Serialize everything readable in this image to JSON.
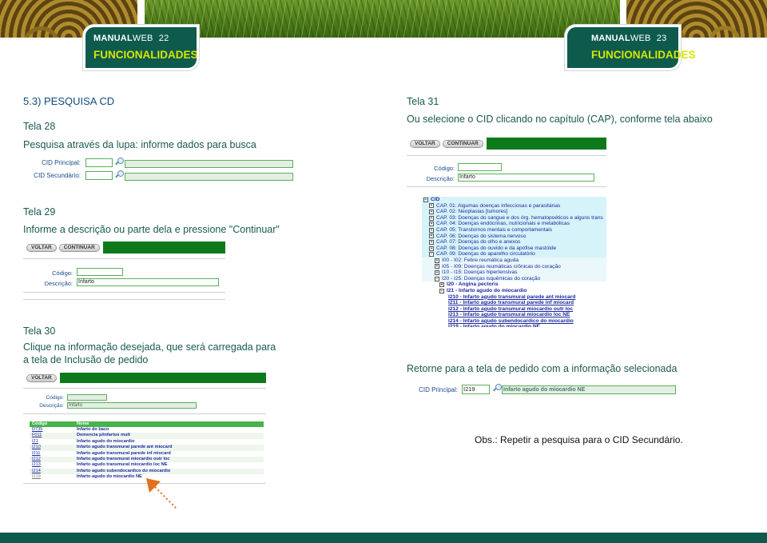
{
  "header": {
    "left": {
      "brand_bold": "MANUAL",
      "brand_light": "WEB",
      "page": "22",
      "section": "FUNCIONALIDADES"
    },
    "right": {
      "brand_bold": "MANUAL",
      "brand_light": "WEB",
      "page": "23",
      "section": "FUNCIONALIDADES"
    }
  },
  "left_page": {
    "section_title": "5.3) PESQUISA CD",
    "tela28": {
      "title": "Tela 28",
      "desc": "Pesquisa através da lupa: informe dados para busca",
      "cid_principal_label": "CID Principal:",
      "cid_secundario_label": "CID Secundário:"
    },
    "tela29": {
      "title": "Tela 29",
      "desc": "Informe a descrição ou parte dela e pressione \"Continuar\"",
      "btn_voltar": "VOLTAR",
      "btn_continuar": "CONTINUAR",
      "codigo_label": "Código:",
      "descricao_label": "Descrição:",
      "descricao_value": "Infarto"
    },
    "tela30": {
      "title": "Tela 30",
      "desc_line1": "Clique na informação desejada, que será carregada para",
      "desc_line2": "a tela de Inclusão de pedido",
      "btn_voltar": "VOLTAR",
      "codigo_label": "Código:",
      "descricao_label": "Descrição:",
      "descricao_value": "Infarto",
      "table_headers": [
        "Código",
        "Nome"
      ],
      "table_rows": [
        [
          "D735",
          "Infarto do baco"
        ],
        [
          "F011",
          "Demencia p/infartos mult"
        ],
        [
          "I21",
          "Infarto agudo do miocardio"
        ],
        [
          "I210",
          "Infarto agudo transmural parede ant miocard"
        ],
        [
          "I211",
          "Infarto agudo transmural parede inf miocard"
        ],
        [
          "I212",
          "Infarto agudo transmural miocardio outr loc"
        ],
        [
          "I213",
          "Infarto agudo transmural miocardio loc NE"
        ],
        [
          "I214",
          "Infarto agudo subendocardico do miocardio"
        ],
        [
          "I219",
          "Infarto agudo do miocardio NE"
        ]
      ]
    }
  },
  "right_page": {
    "tela31": {
      "title": "Tela 31",
      "desc": "Ou selecione o CID clicando no capítulo (CAP), conforme tela abaixo",
      "btn_voltar": "VOLTAR",
      "btn_continuar": "CONTINUAR",
      "codigo_label": "Código:",
      "descricao_label": "Descrição:",
      "descricao_value": "Infarto"
    },
    "tree": [
      {
        "sign": "−",
        "text": "CID",
        "bold": true
      },
      {
        "sign": "+",
        "text": "CAP. 01: Algumas doenças infecciosas e parasitárias"
      },
      {
        "sign": "+",
        "text": "CAP. 02: Neoplasias [tumores]"
      },
      {
        "sign": "+",
        "text": "CAP. 03: Doenças do sangue e dos órg. hematopoéticos e alguns trans"
      },
      {
        "sign": "+",
        "text": "CAP. 04: Doenças endócrinas, nutricionais e metabólicas"
      },
      {
        "sign": "+",
        "text": "CAP. 05: Transtornos mentais e comportamentais"
      },
      {
        "sign": "+",
        "text": "CAP. 06: Doenças do sistema nervoso"
      },
      {
        "sign": "+",
        "text": "CAP. 07: Doenças do olho e anexos"
      },
      {
        "sign": "+",
        "text": "CAP. 08: Doenças do ouvido e da apófise mastóide"
      },
      {
        "sign": "−",
        "text": "CAP. 09: Doenças do aparelho circulatório"
      },
      {
        "sign": "+",
        "text": "I00 - I02: Febre reumática aguda"
      },
      {
        "sign": "+",
        "text": "I05 - I09: Doenças reumáticas crônicas do coração"
      },
      {
        "sign": "+",
        "text": "I10 - I15: Doenças hipertensivas"
      },
      {
        "sign": "−",
        "text": "I20 - I25: Doenças isquêmicas do coração"
      },
      {
        "sign": "+",
        "text": "I20 - Angina pectoris",
        "bold": true
      },
      {
        "sign": "−",
        "text": "I21 - Infarto agudo do miocardio",
        "bold": true
      },
      {
        "sign": "",
        "text": "I210 - Infarto agudo transmural parede ant miocard",
        "bold": true
      },
      {
        "sign": "",
        "text": "I211 - Infarto agudo transmural parede inf miocard",
        "bold": true
      },
      {
        "sign": "",
        "text": "I212 - Infarto agudo transmural miocardio outr loc",
        "bold": true
      },
      {
        "sign": "",
        "text": "I213 - Infarto agudo transmural miocardio loc NE",
        "bold": true
      },
      {
        "sign": "",
        "text": "I214 - Infarto agudo subendocardico do miocardio",
        "bold": true
      },
      {
        "sign": "",
        "text": "I219 - Infarto agudo do miocardio NE",
        "bold": true
      }
    ],
    "return_text": "Retorne para a tela de pedido com a informação selecionada",
    "cid_principal_label": "CID Principal:",
    "cid_principal_code": "I219",
    "cid_principal_desc": "Infarto agudo do miocardio NE",
    "obs": "Obs.: Repetir a pesquisa para o CID Secundário."
  },
  "colors": {
    "accent": "#0e5b4e",
    "lime": "#d8e600",
    "green_bar": "#0c7a1b",
    "arrow": "#e2701e"
  }
}
